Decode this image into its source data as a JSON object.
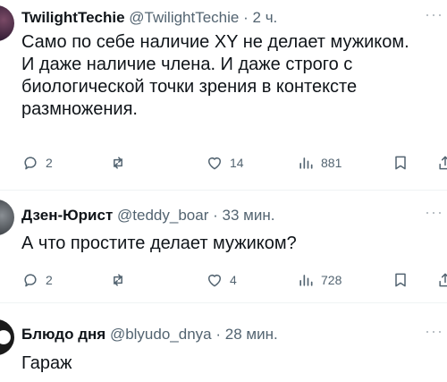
{
  "tweets": [
    {
      "name": "TwilightTechie",
      "handle": "@TwilightTechie",
      "dot": "·",
      "time": "2 ч.",
      "more": "···",
      "text": "Само по себе наличие XY не делает мужиком. И даже наличие члена. И даже строго с биологической точки зрения в контексте размножения.",
      "replies": "2",
      "likes": "14",
      "views": "881"
    },
    {
      "name": "Дзен-Юрист",
      "handle": "@teddy_boar",
      "dot": "·",
      "time": "33 мин.",
      "more": "···",
      "text": "А что простите делает мужиком?",
      "replies": "2",
      "likes": "4",
      "views": "728"
    },
    {
      "name": "Блюдо дня",
      "handle": "@blyudo_dnya",
      "dot": "·",
      "time": "28 мин.",
      "more": "···",
      "text": "Гараж"
    }
  ],
  "icons": {
    "reply": "reply-icon",
    "retweet": "retweet-icon",
    "like": "heart-icon",
    "views": "views-icon",
    "bookmark": "bookmark-icon",
    "share": "share-icon",
    "more": "more-icon"
  },
  "colors": {
    "text": "#0f1419",
    "secondary": "#536471",
    "divider": "#eff3f4"
  }
}
